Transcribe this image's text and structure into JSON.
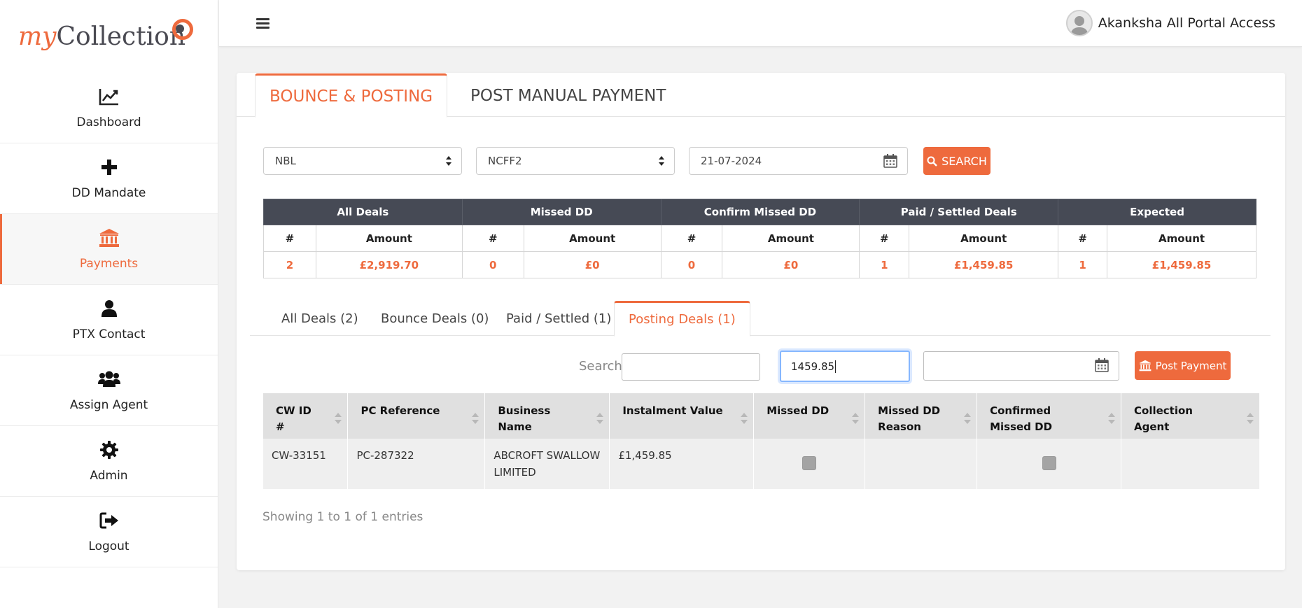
{
  "brand": {
    "my": "my",
    "collection": "Collection"
  },
  "sidebar": {
    "items": [
      {
        "label": "Dashboard",
        "icon": "chart-line-icon"
      },
      {
        "label": "DD Mandate",
        "icon": "plus-icon"
      },
      {
        "label": "Payments",
        "icon": "bank-icon",
        "active": true
      },
      {
        "label": "PTX Contact",
        "icon": "user-icon"
      },
      {
        "label": "Assign Agent",
        "icon": "users-icon"
      },
      {
        "label": "Admin",
        "icon": "gear-icon"
      },
      {
        "label": "Logout",
        "icon": "sign-out-icon"
      }
    ]
  },
  "topbar": {
    "user_name": "Akanksha All Portal Access"
  },
  "main_tabs": [
    {
      "label": "BOUNCE & POSTING",
      "active": true
    },
    {
      "label": "POST MANUAL PAYMENT",
      "active": false
    }
  ],
  "filters": {
    "lender": "NBL",
    "product": "NCFF2",
    "date": "21-07-2024",
    "search_button": "SEARCH"
  },
  "summary": {
    "groups": [
      "All Deals",
      "Missed DD",
      "Confirm Missed DD",
      "Paid / Settled Deals",
      "Expected"
    ],
    "sub_headers": {
      "count": "#",
      "amount": "Amount"
    },
    "values": [
      {
        "count": "2",
        "amount": "£2,919.70"
      },
      {
        "count": "0",
        "amount": "£0"
      },
      {
        "count": "0",
        "amount": "£0"
      },
      {
        "count": "1",
        "amount": "£1,459.85"
      },
      {
        "count": "1",
        "amount": "£1,459.85"
      }
    ]
  },
  "sub_tabs": [
    {
      "label": "All Deals (2)"
    },
    {
      "label": "Bounce Deals (0)"
    },
    {
      "label": "Paid / Settled (1)"
    },
    {
      "label": "Posting Deals (1)",
      "active": true
    }
  ],
  "table_controls": {
    "search_label": "Search:",
    "search_value": "",
    "amount_value": "1459.85",
    "date_value": "",
    "post_button": "Post Payment"
  },
  "table": {
    "columns": [
      "CW ID #",
      "PC Reference",
      "Business Name",
      "Instalment Value",
      "Missed DD",
      "Missed DD Reason",
      "Confirmed Missed DD",
      "Collection Agent"
    ],
    "rows": [
      {
        "cw_id": "CW-33151",
        "pc_ref": "PC-287322",
        "business": "ABCROFT SWALLOW LIMITED",
        "instalment": "£1,459.85",
        "missed_dd": false,
        "reason": "",
        "confirmed": false,
        "agent": ""
      }
    ],
    "info": "Showing 1 to 1 of 1 entries"
  },
  "colors": {
    "accent": "#ee6a3d",
    "header_dark": "#464a55"
  }
}
